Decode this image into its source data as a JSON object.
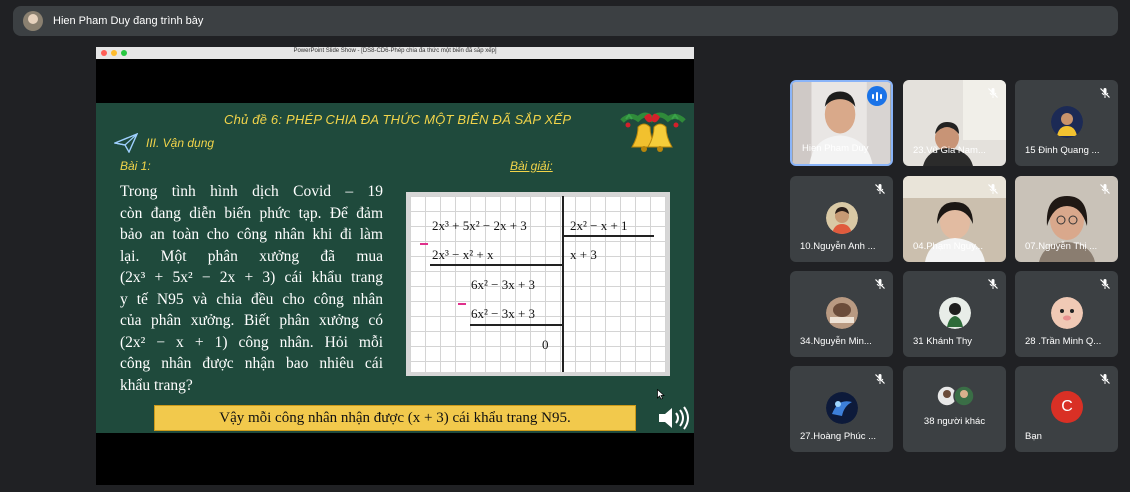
{
  "presenter_bar": {
    "text": "Hien Pham Duy đang trình bày"
  },
  "ppt_window": {
    "title": "PowerPoint Slide Show - [DS8-CD6-Phép chia đa thức một biến đã sắp xếp]"
  },
  "slide": {
    "heading": "Chủ đề 6: PHÉP CHIA ĐA THỨC MỘT BIẾN ĐÃ SẮP XẾP",
    "section": "III. Vận dụng",
    "lesson": "Bài 1:",
    "solution_label": "Bài giải:",
    "problem_lines": [
      "Trong tình hình dịch Covid – 19",
      "còn đang diễn biến phức tạp. Để đảm",
      "bảo an toàn cho công nhân khi đi làm",
      "lại. Một phân xưởng đã mua",
      "(2x³ + 5x² − 2x + 3) cái khẩu trang",
      "y tế N95 và chia đều cho công nhân",
      "của phân xưởng. Biết phân xưởng có",
      "(2x² − x + 1) công nhân. Hỏi mỗi",
      "công nhân được nhận bao nhiêu cái",
      "khẩu trang?"
    ],
    "division": {
      "dividend": "2x³ + 5x² − 2x + 3",
      "divisor": "2x² − x + 1",
      "subtract_1": "2x³ − x² + x",
      "quotient": "x + 3",
      "remainder_1": "6x² − 3x + 3",
      "subtract_2": "6x² − 3x + 3",
      "remainder_final": "0"
    },
    "answer": "Vậy mỗi công nhân nhận được (x + 3) cái khẩu trang N95."
  },
  "participants": [
    {
      "name": "Hien Pham Duy",
      "speaking": true
    },
    {
      "name": "23.Vũ Gia Nam...",
      "muted": true
    },
    {
      "name": "15 Đinh Quang ...",
      "muted": true
    },
    {
      "name": "10.Nguyễn Anh ...",
      "muted": true
    },
    {
      "name": "04.Phạm Nguy...",
      "muted": true
    },
    {
      "name": "07.Nguyễn Thị ...",
      "muted": true
    },
    {
      "name": "34.Nguyễn Min...",
      "muted": true
    },
    {
      "name": "31 Khánh Thy",
      "muted": true
    },
    {
      "name": "28 .Trần Minh Q...",
      "muted": true
    },
    {
      "name": "27.Hoàng Phúc ...",
      "muted": true
    },
    {
      "name": "38 người khác"
    },
    {
      "name": "Bạn",
      "initial": "C",
      "muted": true
    }
  ],
  "colors": {
    "meet_background": "#202124",
    "tile_background": "#3c4043",
    "slide_background": "#1f4a3c",
    "slide_accent": "#f2d44a",
    "answer_box": "#f2c94c",
    "active_speaker_border": "#8ab4f8",
    "you_avatar": "#d93025"
  }
}
